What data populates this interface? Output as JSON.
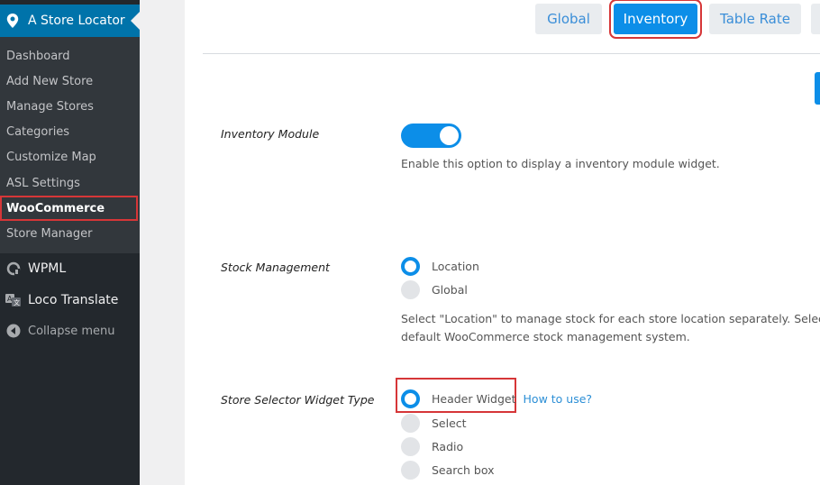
{
  "sidebar": {
    "active_plugin": "A Store Locator",
    "submenu": [
      "Dashboard",
      "Add New Store",
      "Manage Stores",
      "Categories",
      "Customize Map",
      "ASL Settings",
      "WooCommerce",
      "Store Manager"
    ],
    "current_index": 6,
    "menu": [
      {
        "label": "WPML",
        "icon": "wpml-icon"
      },
      {
        "label": "Loco Translate",
        "icon": "translate-icon"
      },
      {
        "label": "Collapse menu",
        "icon": "collapse-icon"
      }
    ]
  },
  "tabs": [
    {
      "label": "Global",
      "active": false
    },
    {
      "label": "Inventory",
      "active": true
    },
    {
      "label": "Table Rate",
      "active": false
    }
  ],
  "settings": {
    "inventory_module": {
      "label": "Inventory Module",
      "enabled": true,
      "help": "Enable this option to display a inventory module widget."
    },
    "stock_management": {
      "label": "Stock Management",
      "options": [
        "Location",
        "Global"
      ],
      "selected": "Location",
      "help_line1": "Select \"Location\" to manage stock for each store location separately. Select \"G",
      "help_line2": "default WooCommerce stock management system."
    },
    "widget_type": {
      "label": "Store Selector Widget Type",
      "options": [
        "Header Widget",
        "Select",
        "Radio",
        "Search box"
      ],
      "selected": "Header Widget",
      "link": "How to use?"
    }
  },
  "colors": {
    "accent": "#0c8ee8",
    "sidebar_bg": "#23282d",
    "sidebar_active": "#0073aa",
    "highlight": "#d63638"
  }
}
